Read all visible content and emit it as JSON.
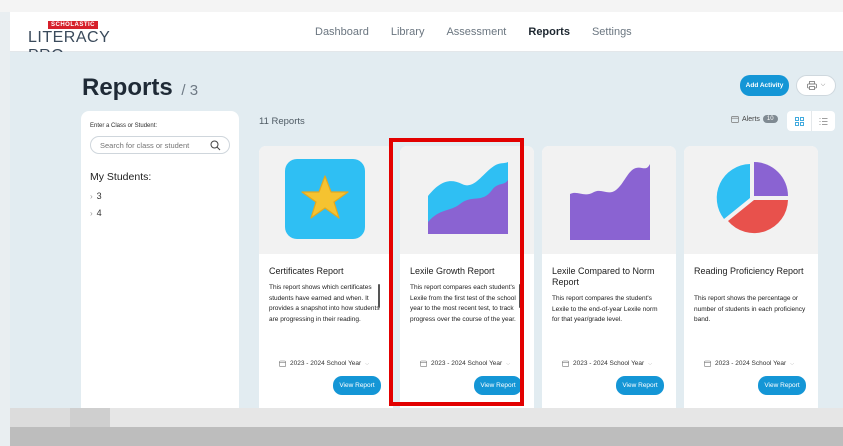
{
  "logo": {
    "small": "SCHOLASTIC",
    "main": "LITERACY PRO"
  },
  "nav": [
    {
      "label": "Dashboard",
      "active": false
    },
    {
      "label": "Library",
      "active": false
    },
    {
      "label": "Assessment",
      "active": false
    },
    {
      "label": "Reports",
      "active": true
    },
    {
      "label": "Settings",
      "active": false
    }
  ],
  "page": {
    "title": "Reports",
    "count": "/ 3"
  },
  "toolbar": {
    "add_activity": "Add Activity"
  },
  "sidebar": {
    "label": "Enter a Class or Student:",
    "search_placeholder": "Search for class or student",
    "my_students": "My Students:",
    "students": [
      "3",
      "4"
    ]
  },
  "reports_count": "11 Reports",
  "alerts": {
    "label": "Alerts",
    "count": "10"
  },
  "colors": {
    "accent": "#1496d6",
    "purple": "#8a63d2",
    "cyan": "#2fbff3",
    "red": "#e8514c",
    "highlight": "#e20000"
  },
  "cards": [
    {
      "title": "Certificates Report",
      "icon": "star-certificate-icon",
      "description": "This report shows which certificates students have earned and when. It provides a snapshot into how students are progressing in their reading.",
      "year": "2023 - 2024 School Year",
      "button": "View Report"
    },
    {
      "title": "Lexile Growth Report",
      "icon": "growth-area-chart-icon",
      "description": "This report compares each student's Lexile from the first test of the school year to the most recent test, to track progress over the course of the year.",
      "year": "2023 - 2024 School Year",
      "button": "View Report"
    },
    {
      "title": "Lexile Compared to Norm Report",
      "icon": "area-chart-icon",
      "description": "This report compares the student's Lexile to the end-of-year Lexile norm for that year/grade level.",
      "year": "2023 - 2024 School Year",
      "button": "View Report"
    },
    {
      "title": "Reading Proficiency Report",
      "icon": "pie-chart-icon",
      "description": "This report shows the percentage or number of students in each proficiency band.",
      "year": "2023 - 2024 School Year",
      "button": "View Report"
    }
  ]
}
